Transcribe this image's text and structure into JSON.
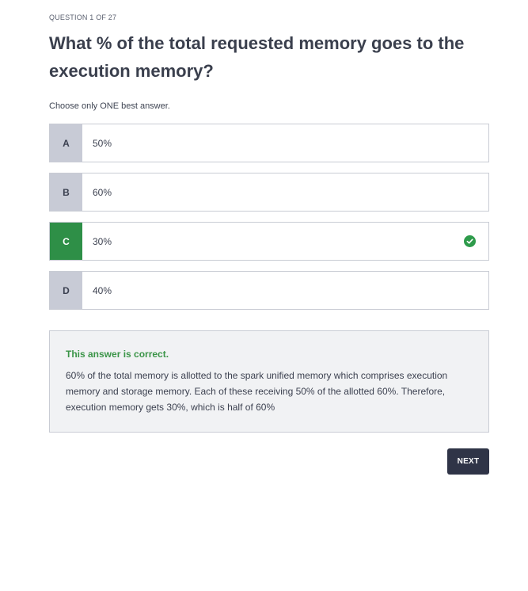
{
  "quiz": {
    "counter": "QUESTION 1 OF 27",
    "question": "What % of the total requested memory goes to the execution memory?",
    "instruction": "Choose only ONE best answer.",
    "options": [
      {
        "letter": "A",
        "text": "50%",
        "correct": false
      },
      {
        "letter": "B",
        "text": "60%",
        "correct": false
      },
      {
        "letter": "C",
        "text": "30%",
        "correct": true
      },
      {
        "letter": "D",
        "text": "40%",
        "correct": false
      }
    ],
    "feedback": {
      "status": "This answer is correct.",
      "explanation": "60% of the total memory is allotted to the spark unified memory which comprises execution memory and storage memory. Each of these receiving 50% of the allotted 60%. Therefore, execution memory gets 30%, which is half of 60%"
    },
    "next_label": "NEXT"
  },
  "icons": {
    "correct": "check-circle-icon"
  },
  "colors": {
    "correct_green": "#2e8f47",
    "status_green": "#3a9447",
    "letter_bg": "#c8cbd6",
    "button_bg": "#2f3447",
    "feedback_bg": "#f1f2f4"
  }
}
